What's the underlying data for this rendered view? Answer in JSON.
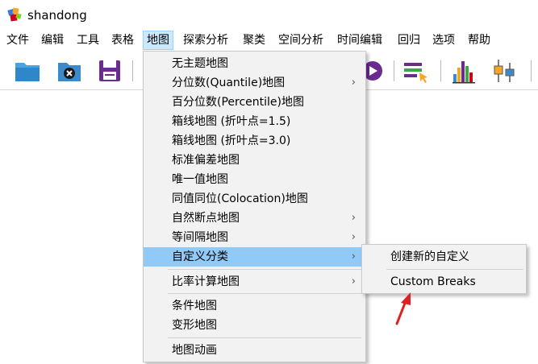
{
  "window": {
    "title": "shandong"
  },
  "menubar": {
    "items": [
      "文件",
      "编辑",
      "工具",
      "表格",
      "地图",
      "探索分析",
      "聚类",
      "空间分析",
      "时间编辑",
      "回归",
      "选项",
      "帮助"
    ],
    "active": "地图"
  },
  "toolbar": {
    "buttons": [
      "open-folder-icon",
      "close-file-icon",
      "save-icon",
      "play-icon",
      "select-icon",
      "histogram-icon",
      "boxplot-icon"
    ]
  },
  "map_menu": {
    "items": [
      {
        "label": "无主题地图",
        "submenu": false
      },
      {
        "label": "分位数(Quantile)地图",
        "submenu": true
      },
      {
        "label": "百分位数(Percentile)地图",
        "submenu": false
      },
      {
        "label": "箱线地图 (折叶点=1.5)",
        "submenu": false
      },
      {
        "label": "箱线地图 (折叶点=3.0)",
        "submenu": false
      },
      {
        "label": "标准偏差地图",
        "submenu": false
      },
      {
        "label": "唯一值地图",
        "submenu": false
      },
      {
        "label": "同值同位(Colocation)地图",
        "submenu": false
      },
      {
        "label": "自然断点地图",
        "submenu": true
      },
      {
        "label": "等间隔地图",
        "submenu": true
      },
      {
        "label": "自定义分类",
        "submenu": true
      },
      {
        "label": "比率计算地图",
        "submenu": true
      },
      {
        "label": "条件地图",
        "submenu": false
      },
      {
        "label": "变形地图",
        "submenu": false
      },
      {
        "label": "地图动画",
        "submenu": false
      }
    ],
    "arrow": "›",
    "highlighted": "自定义分类"
  },
  "custom_submenu": {
    "items": [
      "创建新的自定义",
      "Custom Breaks"
    ]
  },
  "colors": {
    "highlight": "#91c9f7",
    "menu_bg": "#f2f2f2",
    "annotation_arrow": "#e02020"
  }
}
